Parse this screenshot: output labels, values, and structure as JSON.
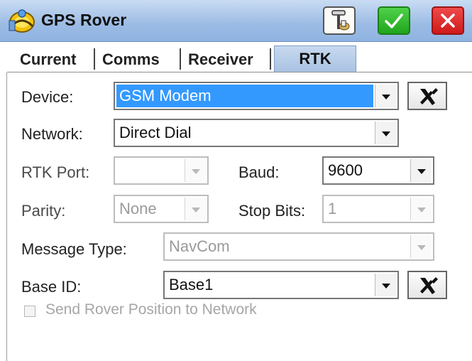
{
  "window": {
    "title": "GPS Rover"
  },
  "toolbar": {
    "receiver_icon": "gps-receiver-icon",
    "ok_icon": "checkmark-icon",
    "cancel_icon": "close-icon"
  },
  "tabs": [
    {
      "label": "Current"
    },
    {
      "label": "Comms"
    },
    {
      "label": "Receiver"
    },
    {
      "label": "RTK",
      "active": true
    }
  ],
  "form": {
    "device": {
      "label": "Device:",
      "value": "GSM Modem"
    },
    "network": {
      "label": "Network:",
      "value": "Direct Dial"
    },
    "rtk_port": {
      "label": "RTK Port:",
      "value": ""
    },
    "baud": {
      "label": "Baud:",
      "value": "9600"
    },
    "parity": {
      "label": "Parity:",
      "value": "None"
    },
    "stop_bits": {
      "label": "Stop Bits:",
      "value": "1"
    },
    "message_type": {
      "label": "Message Type:",
      "value": "NavCom"
    },
    "base_id": {
      "label": "Base ID:",
      "value": "Base1"
    },
    "send_rover_position": {
      "label": "Send Rover Position to Network",
      "checked": false,
      "enabled": false
    }
  },
  "colors": {
    "selection": "#3399ff",
    "ok": "#20a51c",
    "cancel": "#cf1a1a",
    "titlebar": "#9bbbe4"
  }
}
